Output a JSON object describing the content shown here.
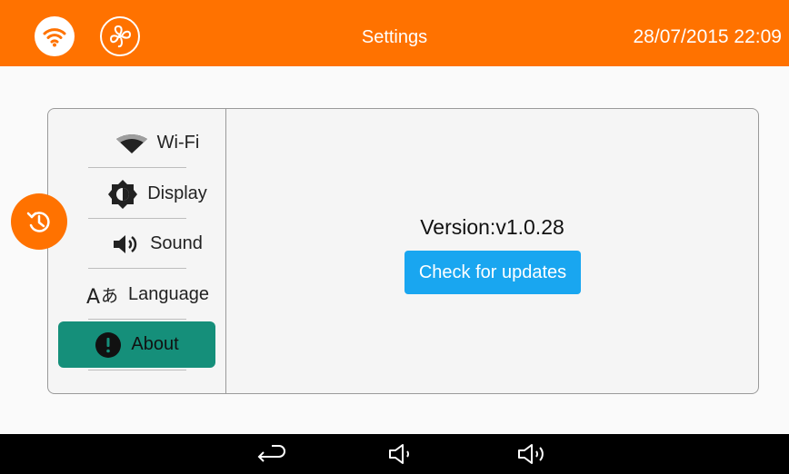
{
  "header": {
    "title": "Settings",
    "datetime": "28/07/2015 22:09",
    "icons": [
      "wifi-icon",
      "fan-icon"
    ],
    "color": "#ff7200"
  },
  "sidebar": {
    "items": [
      {
        "label": "Wi-Fi",
        "icon": "wifi-icon"
      },
      {
        "label": "Display",
        "icon": "brightness-icon"
      },
      {
        "label": "Sound",
        "icon": "speaker-icon"
      },
      {
        "label": "Language",
        "icon": "language-icon"
      },
      {
        "label": "About",
        "icon": "info-icon",
        "selected": true
      }
    ],
    "active_color": "#158f7a"
  },
  "main": {
    "version_text": "Version:v1.0.28",
    "update_button": "Check for updates",
    "button_color": "#19a6f0"
  },
  "navbar": {
    "buttons": [
      "back-icon",
      "volume-down-icon",
      "volume-up-icon"
    ]
  }
}
